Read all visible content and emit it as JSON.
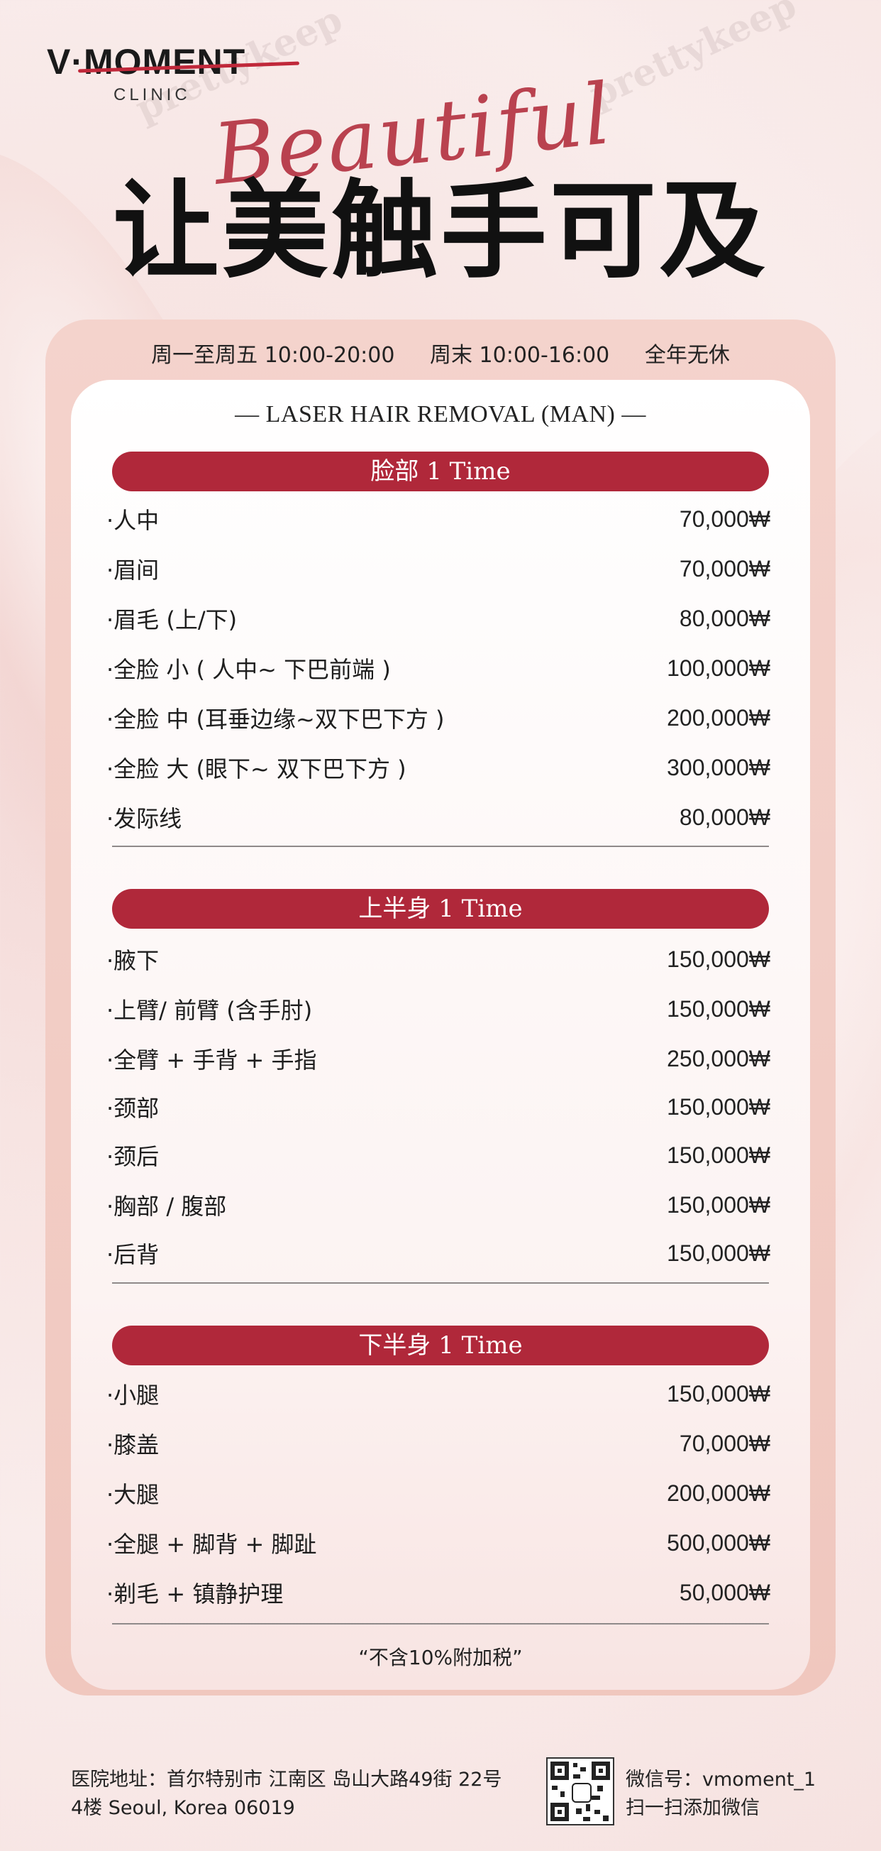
{
  "brand": {
    "logo_main": "V·MOMENT",
    "logo_sub": "CLINIC"
  },
  "header": {
    "script_word": "Beautiful",
    "title": "让美触手可及"
  },
  "hours": {
    "weekday": "周一至周五 10:00-20:00",
    "weekend": "周末 10:00-16:00",
    "note": "全年无休"
  },
  "menu": {
    "title": "— LASER HAIR REMOVAL (MAN) —",
    "sections": [
      {
        "label": "脸部  1 Time",
        "items": [
          {
            "name": "·人中",
            "price": "70,000₩"
          },
          {
            "name": "·眉间",
            "price": "70,000₩"
          },
          {
            "name": "·眉毛 (上/下)",
            "price": "80,000₩"
          },
          {
            "name": "·全脸 小 ( 人中~ 下巴前端 )",
            "price": "100,000₩"
          },
          {
            "name": "·全脸 中 (耳垂边缘~双下巴下方 )",
            "price": "200,000₩"
          },
          {
            "name": "·全脸 大 (眼下~ 双下巴下方 )",
            "price": "300,000₩"
          },
          {
            "name": "·发际线",
            "price": "80,000₩"
          }
        ]
      },
      {
        "label": "上半身  1 Time",
        "items": [
          {
            "name": "·腋下",
            "price": "150,000₩"
          },
          {
            "name": "·上臂/ 前臂 (含手肘)",
            "price": "150,000₩"
          },
          {
            "name": "·全臂 + 手背 + 手指",
            "price": "250,000₩"
          },
          {
            "name": "·颈部",
            "price": "150,000₩"
          },
          {
            "name": "·颈后",
            "price": "150,000₩"
          },
          {
            "name": "·胸部 / 腹部",
            "price": "150,000₩"
          },
          {
            "name": "·后背",
            "price": "150,000₩"
          }
        ]
      },
      {
        "label": "下半身  1 Time",
        "items": [
          {
            "name": "·小腿",
            "price": "150,000₩"
          },
          {
            "name": "·膝盖",
            "price": "70,000₩"
          },
          {
            "name": "·大腿",
            "price": "200,000₩"
          },
          {
            "name": "·全腿 + 脚背 + 脚趾",
            "price": "500,000₩"
          },
          {
            "name": "·剃毛 + 镇静护理",
            "price": "50,000₩"
          }
        ]
      }
    ],
    "tax_note": "“不含10%附加税”"
  },
  "footer": {
    "address_line1": "医院地址：首尔特别市 江南区 岛山大路49街 22号",
    "address_line2": "4楼 Seoul, Korea 06019",
    "wechat_id": "微信号：vmoment_1",
    "wechat_cta": "扫一扫添加微信",
    "qr_icon": "wechat-qr-code"
  },
  "watermark": "prettykeep",
  "colors": {
    "accent": "#b0283a",
    "panel_outer": "#f0c7be",
    "panel_inner": "#ffffff"
  }
}
